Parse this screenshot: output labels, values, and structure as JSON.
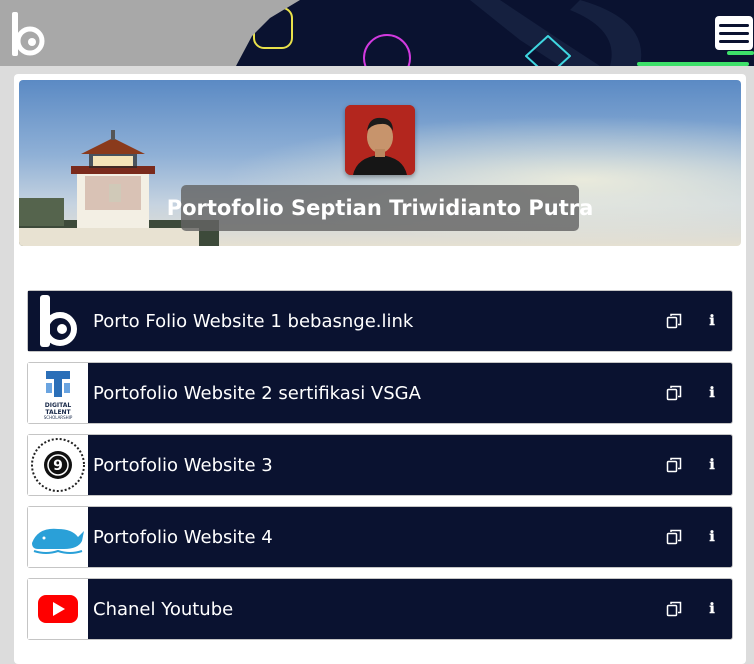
{
  "header": {
    "logo_icon": "bebasnge-logo-icon",
    "menu_icon": "hamburger-menu-icon"
  },
  "profile": {
    "avatar_icon": "profile-photo",
    "title": "Portofolio Septian Triwidianto Putra"
  },
  "links": [
    {
      "label": "Porto Folio Website 1 bebasnge.link",
      "icon": "bebasnge-logo-icon"
    },
    {
      "label": "Portofolio Website 2 sertifikasi VSGA",
      "icon": "digital-talent-logo-icon",
      "icon_text": "DIGITAL TALENT SCHOLARSHIP"
    },
    {
      "label": "Portofolio Website 3",
      "icon": "dicoding-academy-logo-icon",
      "icon_text": "9"
    },
    {
      "label": "Portofolio Website 4",
      "icon": "whale-logo-icon"
    },
    {
      "label": "Chanel Youtube",
      "icon": "youtube-icon"
    }
  ],
  "colors": {
    "header_bg": "#0a1230",
    "link_bg": "#0a1230",
    "accent_green": "#3ee06a",
    "youtube_red": "#ff0000"
  }
}
